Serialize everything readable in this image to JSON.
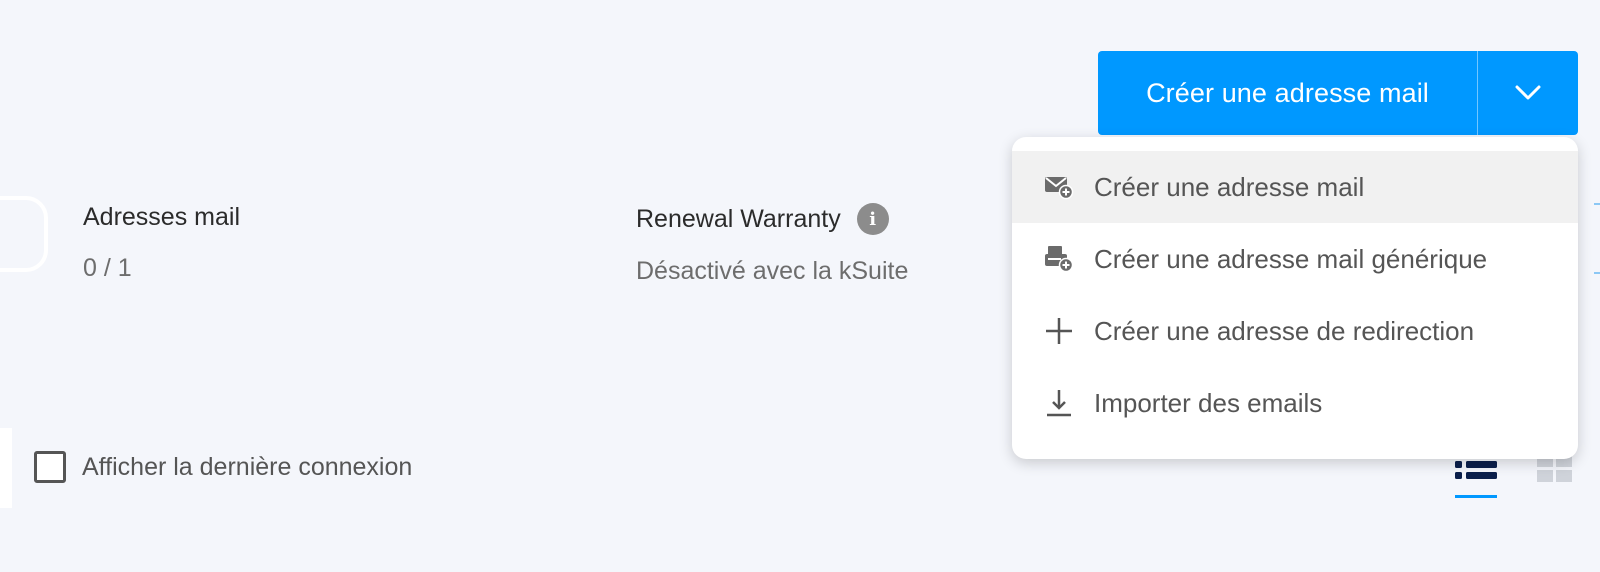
{
  "header": {
    "primary_button": {
      "label": "Créer une adresse mail",
      "caret_icon": "chevron-down-icon",
      "color": "#0098ff"
    }
  },
  "stats": [
    {
      "label": "Adresses mail",
      "value": "0 / 1"
    },
    {
      "label": "Renewal Warranty",
      "value": "Désactivé avec la kSuite",
      "icon": "info-icon"
    }
  ],
  "options": {
    "show_last_login": {
      "label": "Afficher la dernière connexion",
      "checked": false
    }
  },
  "view_toggle": {
    "list_icon": "list-view-icon",
    "grid_icon": "grid-view-icon",
    "active": "list"
  },
  "dropdown_menu": {
    "items": [
      {
        "label": "Créer une adresse mail",
        "icon": "mail-add-icon",
        "highlighted": true
      },
      {
        "label": "Créer une adresse mail générique",
        "icon": "generic-mail-add-icon",
        "highlighted": false
      },
      {
        "label": "Créer une adresse de redirection",
        "icon": "plus-icon",
        "highlighted": false
      },
      {
        "label": "Importer des emails",
        "icon": "download-icon",
        "highlighted": false
      }
    ]
  }
}
